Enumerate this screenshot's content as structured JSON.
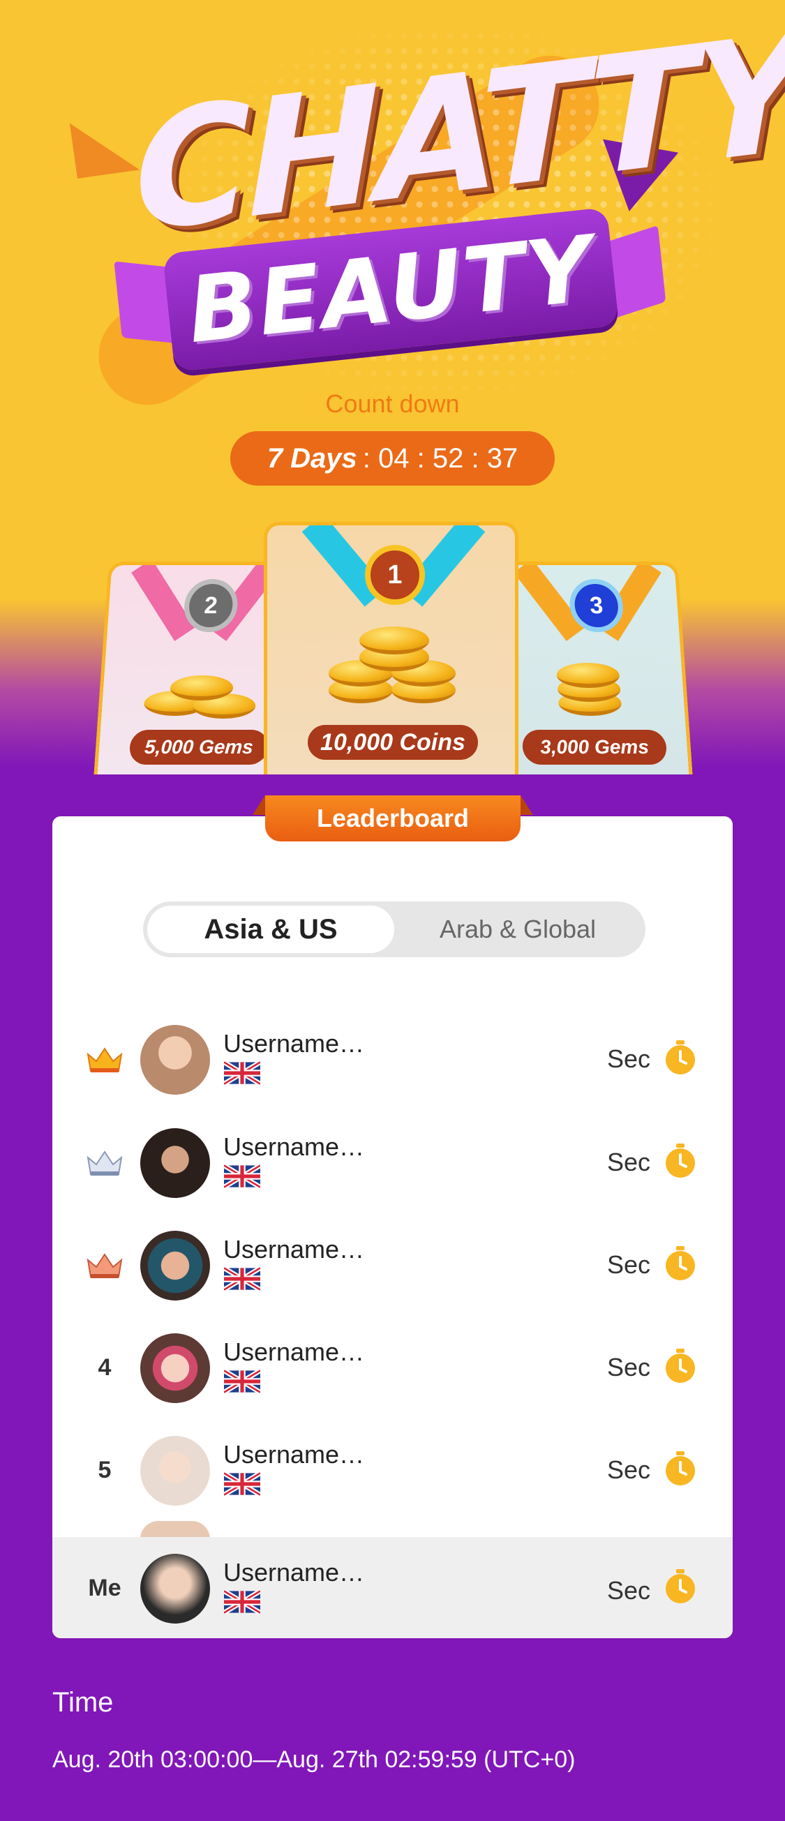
{
  "banner": {
    "title_line1": "CHATTY",
    "title_line2": "BEAUTY"
  },
  "countdown": {
    "label": "Count down",
    "days": "7 Days",
    "time": ": 04 : 52 : 37"
  },
  "prizes": [
    {
      "rank": "1",
      "label": "10,000 Coins"
    },
    {
      "rank": "2",
      "label": "5,000 Gems"
    },
    {
      "rank": "3",
      "label": "3,000 Gems"
    }
  ],
  "leaderboard": {
    "tab_label": "Leaderboard",
    "segments": [
      "Asia & US",
      "Arab & Global"
    ],
    "active_segment": "Asia & US",
    "rows": [
      {
        "rank": "",
        "rank_icon": "gold-crown-icon",
        "username": "Username…",
        "score": "Sec"
      },
      {
        "rank": "",
        "rank_icon": "silver-crown-icon",
        "username": "Username…",
        "score": "Sec"
      },
      {
        "rank": "",
        "rank_icon": "bronze-crown-icon",
        "username": "Username…",
        "score": "Sec"
      },
      {
        "rank": "4",
        "rank_icon": "",
        "username": "Username…",
        "score": "Sec"
      },
      {
        "rank": "5",
        "rank_icon": "",
        "username": "Username…",
        "score": "Sec"
      }
    ],
    "me": {
      "rank": "Me",
      "username": "Username…",
      "score": "Sec"
    }
  },
  "time_info": {
    "title": "Time",
    "range": "Aug. 20th 03:00:00—Aug. 27th 02:59:59 (UTC+0)"
  },
  "colors": {
    "background_purple": "#8117b8",
    "background_yellow": "#f9c532",
    "accent_orange": "#ea6a17",
    "timer_yellow": "#f8b622"
  }
}
